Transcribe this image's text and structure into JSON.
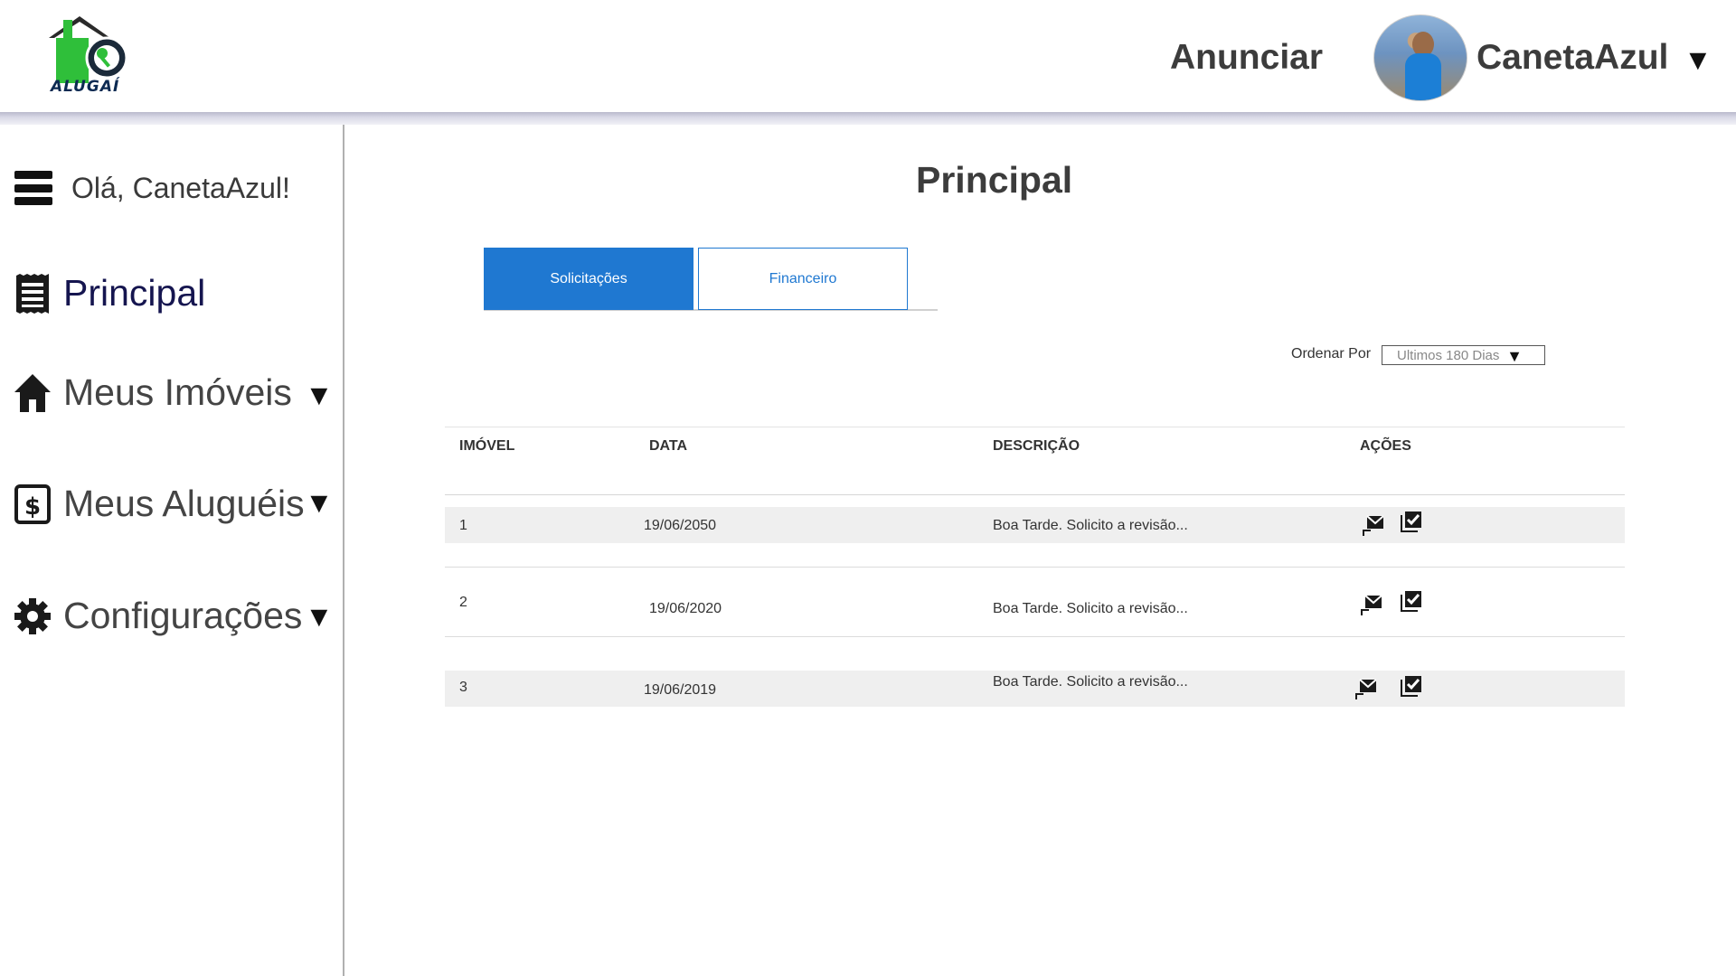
{
  "header": {
    "logo_text": "ALUGAÍ",
    "anunciar_label": "Anunciar",
    "user_name": "CanetaAzul",
    "user_caret": "▼"
  },
  "sidebar": {
    "greeting": "Olá, CanetaAzul!",
    "items": [
      {
        "label": "Principal",
        "icon": "receipt-icon",
        "caret": ""
      },
      {
        "label": "Meus Imóveis",
        "icon": "home-icon",
        "caret": "▼"
      },
      {
        "label": "Meus Aluguéis",
        "icon": "dollar-box-icon",
        "caret": "▼"
      },
      {
        "label": "Configurações",
        "icon": "gear-icon",
        "caret": "▼"
      }
    ]
  },
  "main": {
    "title": "Principal",
    "tabs": [
      {
        "label": "Solicitações",
        "active": true
      },
      {
        "label": "Financeiro",
        "active": false
      }
    ],
    "order": {
      "label": "Ordenar Por",
      "value": "Ultimos 180 Dias",
      "arrow": "▼"
    },
    "table": {
      "headers": [
        "IMÓVEL",
        "DATA",
        "DESCRIÇÃO",
        "AÇÕES"
      ],
      "rows": [
        {
          "imovel": "1",
          "data": "19/06/2050",
          "descricao": "Boa Tarde. Solicito a revisão..."
        },
        {
          "imovel": "2",
          "data": "19/06/2020",
          "descricao": "Boa Tarde. Solicito a revisão..."
        },
        {
          "imovel": "3",
          "data": "19/06/2019",
          "descricao": "Boa Tarde. Solicito a revisão..."
        }
      ]
    }
  },
  "colors": {
    "accent": "#1f78d1",
    "active_nav": "#15154f",
    "logo_green": "#2fbf3a"
  }
}
